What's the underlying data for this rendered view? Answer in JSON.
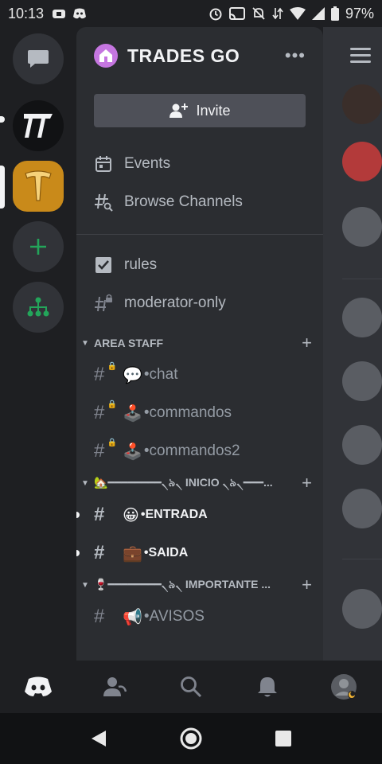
{
  "status_bar": {
    "time": "10:13",
    "battery": "97%"
  },
  "server_rail": {
    "items": [
      {
        "name": "direct-messages",
        "icon": "chat-bubble-icon"
      },
      {
        "name": "server-tt",
        "icon": "tt-logo-icon"
      },
      {
        "name": "server-trades-go",
        "icon": "trades-go-logo-icon",
        "selected": true
      },
      {
        "name": "add-server",
        "icon": "plus-icon"
      },
      {
        "name": "explore-servers",
        "icon": "hierarchy-icon"
      }
    ]
  },
  "drawer": {
    "guild_name": "TRADES GO",
    "more": "•••",
    "invite_label": "Invite",
    "nav": [
      {
        "label": "Events",
        "icon": "calendar-icon"
      },
      {
        "label": "Browse Channels",
        "icon": "browse-channels-icon"
      }
    ],
    "channels_top": [
      {
        "label": "rules",
        "icon": "rules-checkbox-icon"
      },
      {
        "label": "moderator-only",
        "icon": "locked-hash-icon"
      }
    ],
    "categories": [
      {
        "label": "AREA STAFF",
        "channels": [
          {
            "emoji": "💬",
            "label": "•chat",
            "locked": true
          },
          {
            "emoji": "🕹️",
            "label": "•commandos",
            "locked": true
          },
          {
            "emoji": "🕹️",
            "label": "•commandos2",
            "locked": true
          }
        ]
      },
      {
        "label": "🏡━━━━━━━━৲৯৲ INICIO ৲৯৲━━━...",
        "channels": [
          {
            "emoji": "😀",
            "label": "•ENTRADA",
            "unread": true
          },
          {
            "emoji": "💼",
            "label": "•SAIDA",
            "unread": true
          }
        ]
      },
      {
        "label": "🍷━━━━━━━━৲৯৲ IMPORTANTE ...",
        "channels": [
          {
            "emoji": "📢",
            "label": "•AVISOS"
          }
        ]
      }
    ]
  },
  "bottom_nav": [
    {
      "name": "home-tab",
      "icon": "discord-logo-icon",
      "active": true
    },
    {
      "name": "friends-tab",
      "icon": "friends-icon"
    },
    {
      "name": "search-tab",
      "icon": "search-icon"
    },
    {
      "name": "notifications-tab",
      "icon": "bell-icon"
    },
    {
      "name": "profile-tab",
      "icon": "avatar-icon"
    }
  ],
  "colors": {
    "rail_bg": "#1e1f22",
    "drawer_bg": "#2b2d31",
    "accent_green": "#23a55a",
    "gold_server": "#d99a22"
  }
}
